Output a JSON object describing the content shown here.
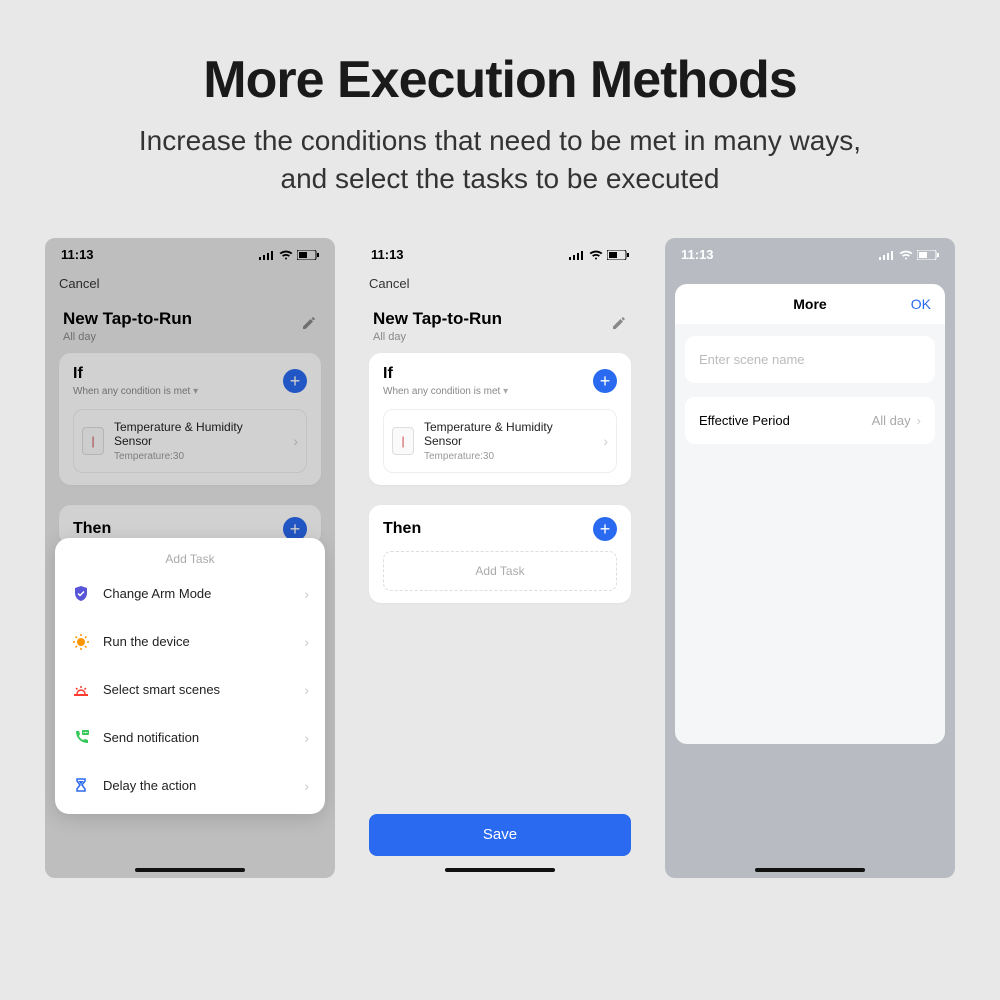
{
  "hero": {
    "title": "More Execution Methods",
    "subtitle": "Increase the conditions that need to be met in many ways,\nand select the tasks to be executed"
  },
  "common": {
    "time": "11:13",
    "cancel": "Cancel",
    "new_tap": "New Tap-to-Run",
    "all_day": "All day",
    "if": "If",
    "if_cond": "When any condition is met",
    "then": "Then",
    "add_task": "Add Task",
    "sensor_name": "Temperature & Humidity Sensor",
    "sensor_val": "Temperature:30",
    "save": "Save"
  },
  "sheet": {
    "title": "Add Task",
    "items": [
      {
        "label": "Change Arm Mode",
        "icon": "shield"
      },
      {
        "label": "Run the device",
        "icon": "sun"
      },
      {
        "label": "Select smart scenes",
        "icon": "scene"
      },
      {
        "label": "Send notification",
        "icon": "phone"
      },
      {
        "label": "Delay the action",
        "icon": "hourglass"
      }
    ]
  },
  "more": {
    "title": "More",
    "ok": "OK",
    "placeholder": "Enter scene name",
    "effective": "Effective Period",
    "effective_val": "All day"
  }
}
